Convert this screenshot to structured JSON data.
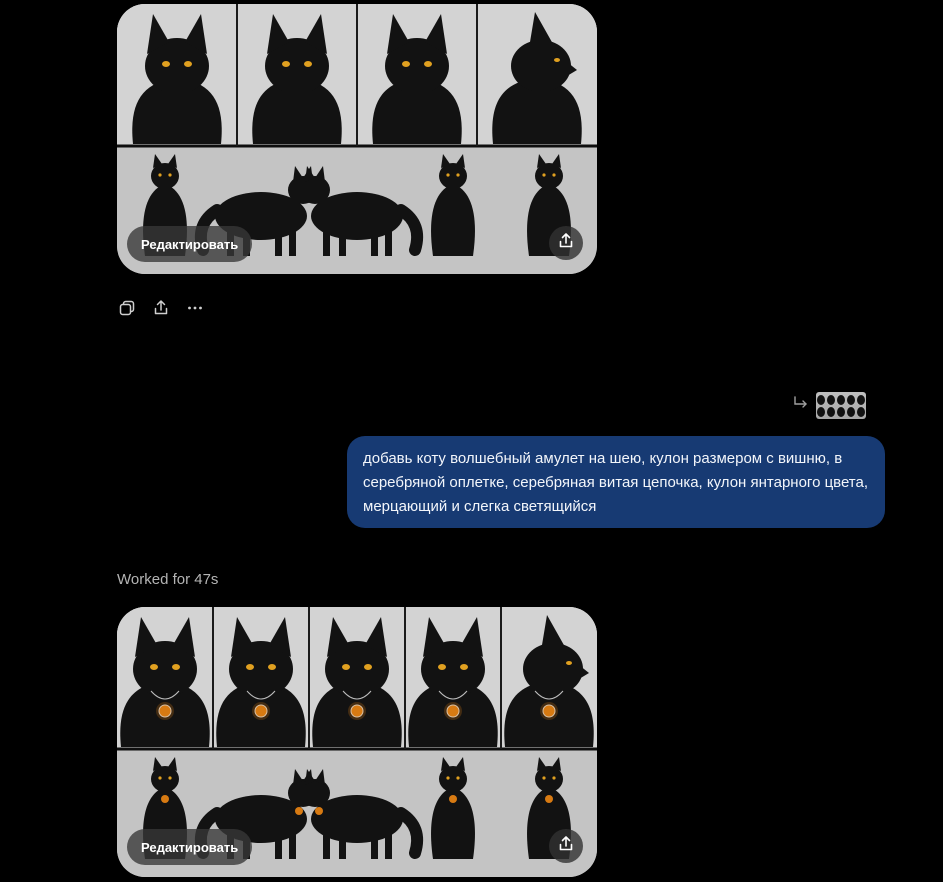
{
  "generated_images": [
    {
      "edit_label": "Редактировать",
      "share_icon": "share-icon",
      "has_amulet": false
    },
    {
      "edit_label": "Редактировать",
      "share_icon": "share-icon",
      "has_amulet": true
    }
  ],
  "message_actions": {
    "icons": [
      "copy-icon",
      "share-icon",
      "more-icon"
    ]
  },
  "reply_reference": {
    "arrow_icon": "reply-arrow-icon"
  },
  "user_message": {
    "text": "добавь коту волшебный амулет на шею, кулон размером с вишню, в серебряной оплетке, серебряная витая цепочка, кулон янтарного цвета, мерцающий и слегка светящийся"
  },
  "status": {
    "worked_label": "Worked for 47s"
  },
  "colors": {
    "background": "#000000",
    "user_bubble": "#173a73",
    "cat_fur": "#121212",
    "cat_eye": "#e0a020",
    "amulet": "#d77a12"
  }
}
